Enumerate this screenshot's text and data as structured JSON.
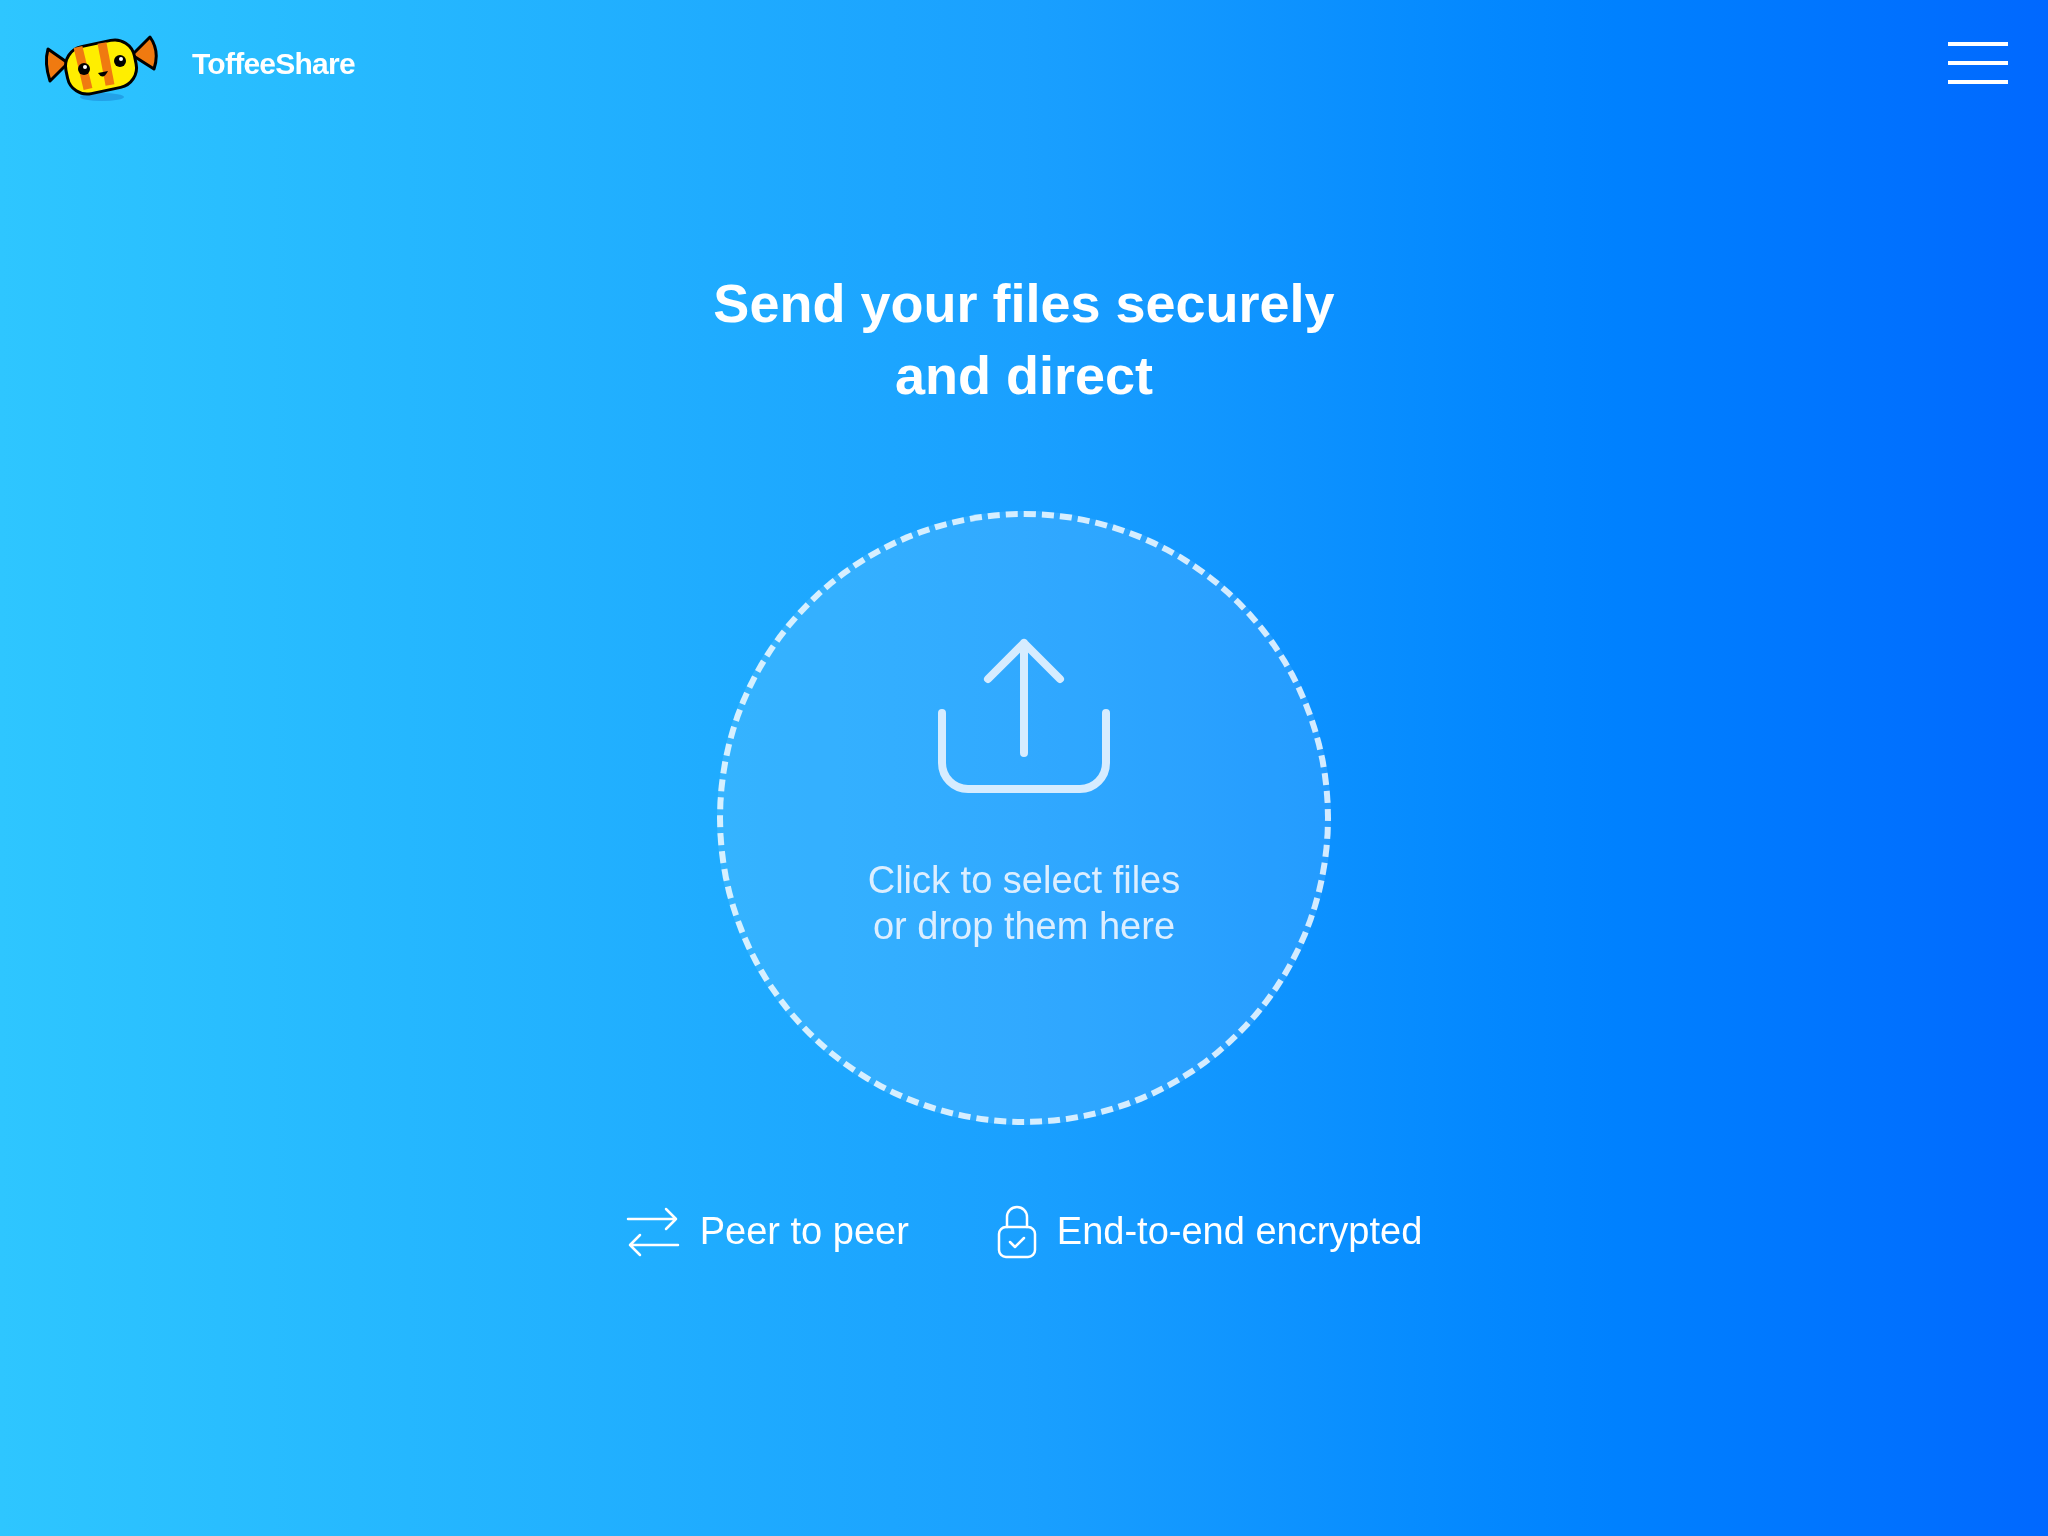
{
  "header": {
    "brand": "ToffeeShare"
  },
  "headline": "Send your files securely and direct",
  "dropzone": {
    "text": "Click to select files or drop them here"
  },
  "features": [
    {
      "kind": "exchange",
      "label": "Peer to peer"
    },
    {
      "kind": "lock",
      "label": "End-to-end encrypted"
    }
  ]
}
